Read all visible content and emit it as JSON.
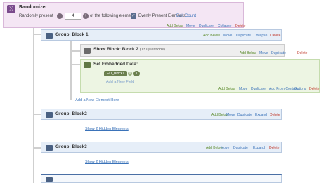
{
  "randomizer": {
    "title": "Randomizer",
    "text_prefix": "Randomly present",
    "count_value": "4",
    "text_suffix": "of the following elements",
    "evenly_label": "Evenly Present Elements",
    "edit_count": "Edit Count",
    "actions": [
      "Add Below",
      "Move",
      "Duplicate",
      "Collapse",
      "Delete"
    ]
  },
  "group1": {
    "title": "Group: Block 1",
    "actions": [
      "Add Below",
      "Move",
      "Duplicate",
      "Collapse",
      "Delete"
    ]
  },
  "show_block": {
    "title": "Show Block: Block 2",
    "subtitle": "(13 Questions)",
    "actions": [
      "Add Below",
      "Move",
      "Duplicate",
      "Delete"
    ]
  },
  "embedded": {
    "title": "Set Embedded Data:",
    "field_name": "EO_Block1",
    "equals": "=",
    "value": "1",
    "add_field": "Add a New Field",
    "actions": [
      "Add Below",
      "Move",
      "Duplicate",
      "Add From Contacts",
      "Options",
      "Delete"
    ]
  },
  "add_element": "Add a New Element Here",
  "group2": {
    "title": "Group: Block2",
    "actions": [
      "Add Below",
      "Move",
      "Duplicate",
      "Expand",
      "Delete"
    ],
    "hidden_link": "Show 2 Hidden Elements"
  },
  "group3": {
    "title": "Group: Block3",
    "actions": [
      "Add Below",
      "Move",
      "Duplicate",
      "Expand",
      "Delete"
    ],
    "hidden_link": "Show 2 Hidden Elements"
  }
}
